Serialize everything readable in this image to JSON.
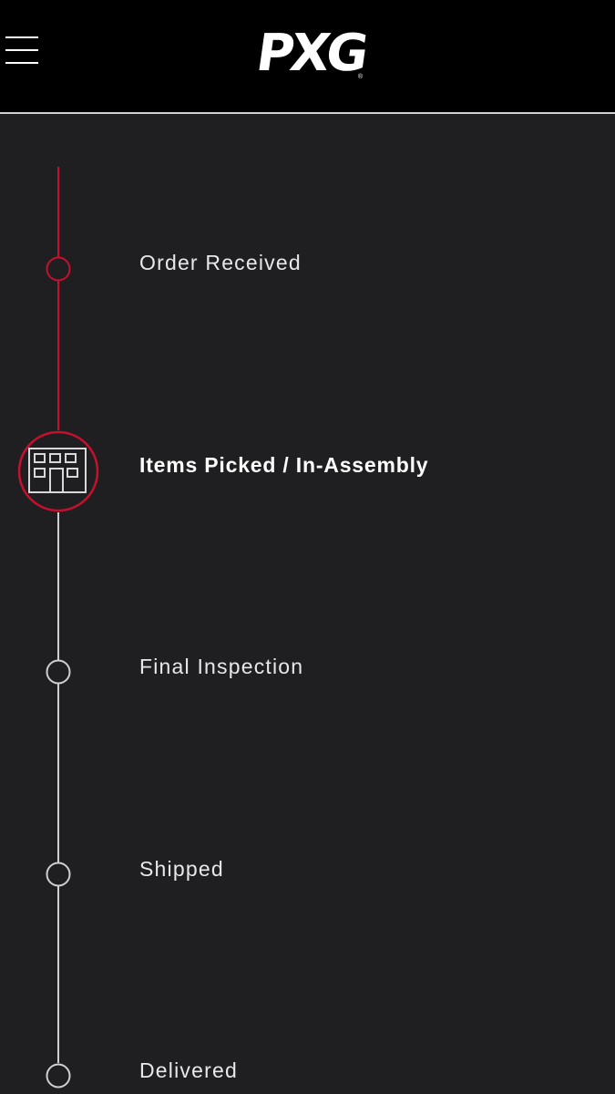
{
  "header": {
    "menu_icon": "hamburger-menu-icon",
    "logo_text": "PXG",
    "logo_reg": "®"
  },
  "colors": {
    "accent": "#c8102e",
    "background": "#1f1f21",
    "header_bg": "#000000",
    "inactive_line": "#d0d0d2"
  },
  "steps": [
    {
      "label": "Order Received",
      "status": "completed"
    },
    {
      "label": "Items Picked / In-Assembly",
      "status": "current",
      "icon": "warehouse-building-icon"
    },
    {
      "label": "Final Inspection",
      "status": "pending"
    },
    {
      "label": "Shipped",
      "status": "pending"
    },
    {
      "label": "Delivered",
      "status": "pending"
    }
  ]
}
